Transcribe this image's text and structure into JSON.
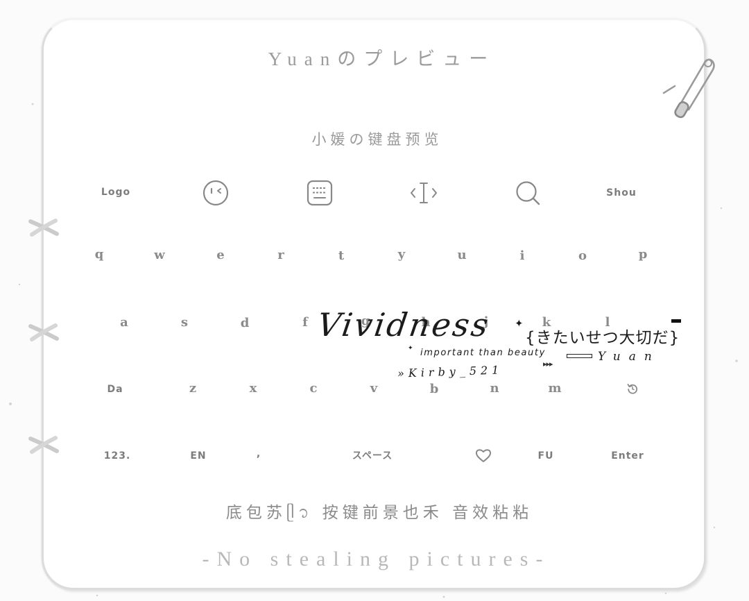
{
  "title": "Yuanのプレビュー",
  "subtitle": "小媛の键盘预览",
  "toolbar": {
    "logo_label": "Logo",
    "collapse_label": "Shou"
  },
  "keys": {
    "row1": [
      "q",
      "w",
      "e",
      "r",
      "t",
      "y",
      "u",
      "i",
      "o",
      "p"
    ],
    "row2": [
      "a",
      "s",
      "d",
      "f",
      "g",
      "h",
      "j",
      "k",
      "l"
    ],
    "row3": [
      "Da",
      "z",
      "x",
      "c",
      "v",
      "b",
      "n",
      "m"
    ],
    "row4": {
      "numbers": "123.",
      "language": "EN",
      "comma": ",",
      "space": "スペース",
      "fu": "FU",
      "enter": "Enter"
    }
  },
  "overlay": {
    "script_word": "Vividness",
    "sparkle": "✦",
    "jp_phrase": "{きたいせつ大切だ}",
    "tagline": "important than beauty",
    "arrows": "▸▸▸",
    "signature": "Yuan",
    "author": "»Kirby_521"
  },
  "credits": "底包苏ᥫ᭡ 按键前景也禾 音效粘粘",
  "footer": "-No stealing pictures-",
  "icons": {
    "toolbar": [
      "emoji-face-icon",
      "keyboard-icon",
      "cursor-icon",
      "search-icon"
    ],
    "row3_end": "undo-icon",
    "row4_emoji": "heart-icon",
    "decor": [
      "safety-pin-icon",
      "stitch-cross-icon"
    ]
  },
  "colors": {
    "card_background": "#ffffff",
    "key_text": "#8a8a8a",
    "title_text": "#9b9b9b",
    "overlay_text": "#1b1b1b",
    "footer_text": "#b8b8b8"
  }
}
